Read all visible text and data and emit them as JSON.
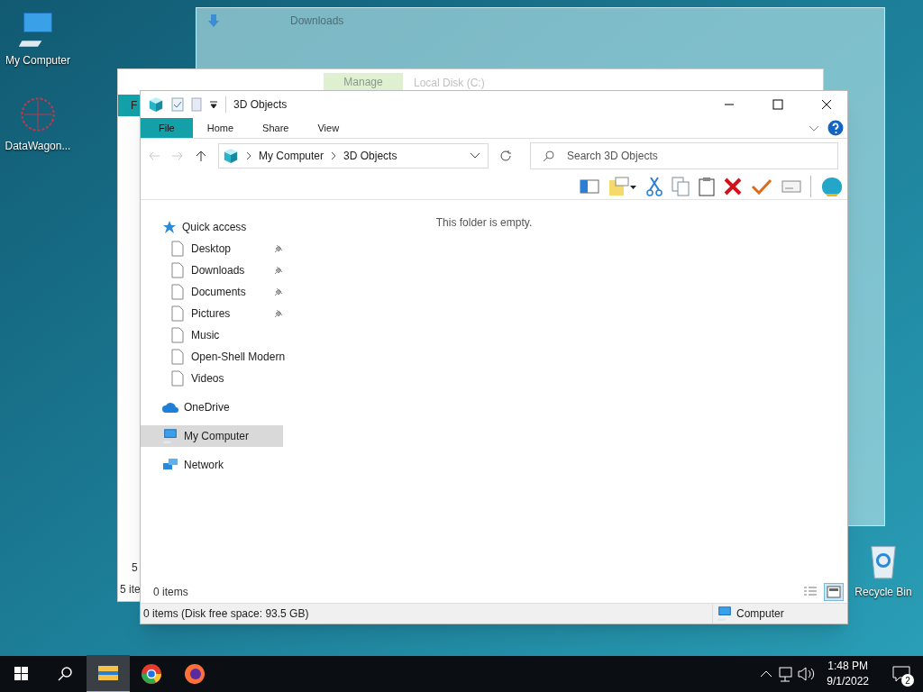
{
  "desktop_icons": [
    {
      "label": "My Computer",
      "kind": "computer"
    },
    {
      "label": "DataWagon...",
      "kind": "shortcut"
    },
    {
      "label": "Recycle Bin",
      "kind": "recycle"
    }
  ],
  "background_windows": {
    "downloads": {
      "title": "Downloads"
    },
    "local_disk": {
      "context_tab": "Manage",
      "title": "Local Disk (C:)",
      "ribbon_tab": "F",
      "item_count": "5",
      "status": "5 ite"
    }
  },
  "window": {
    "title": "3D Objects",
    "tabs": [
      {
        "label": "File",
        "selected": true
      },
      {
        "label": "Home",
        "selected": false
      },
      {
        "label": "Share",
        "selected": false
      },
      {
        "label": "View",
        "selected": false
      }
    ],
    "breadcrumb": [
      "My Computer",
      "3D Objects"
    ],
    "search": {
      "placeholder": "Search 3D Objects"
    },
    "empty_message": "This folder is empty.",
    "nav": [
      {
        "label": "Quick access",
        "kind": "quick",
        "selected": false,
        "children": [
          {
            "label": "Desktop",
            "pinned": true
          },
          {
            "label": "Downloads",
            "pinned": true
          },
          {
            "label": "Documents",
            "pinned": true
          },
          {
            "label": "Pictures",
            "pinned": true
          },
          {
            "label": "Music",
            "pinned": false
          },
          {
            "label": "Open-Shell Modern",
            "pinned": false
          },
          {
            "label": "Videos",
            "pinned": false
          }
        ]
      },
      {
        "label": "OneDrive",
        "kind": "cloud",
        "selected": false
      },
      {
        "label": "My Computer",
        "kind": "computer",
        "selected": true
      },
      {
        "label": "Network",
        "kind": "network",
        "selected": false
      }
    ],
    "item_count": "0 items",
    "views": [
      {
        "kind": "details",
        "selected": false
      },
      {
        "kind": "tiles",
        "selected": true
      }
    ],
    "status": "0 items (Disk free space: 93.5 GB)",
    "zone": "Computer"
  },
  "taskbar": {
    "apps": [
      {
        "kind": "explorer",
        "selected": true
      },
      {
        "kind": "chrome",
        "selected": false
      },
      {
        "kind": "firefox",
        "selected": false
      }
    ],
    "time": "1:48 PM",
    "date": "9/1/2022",
    "notifications": "2"
  }
}
